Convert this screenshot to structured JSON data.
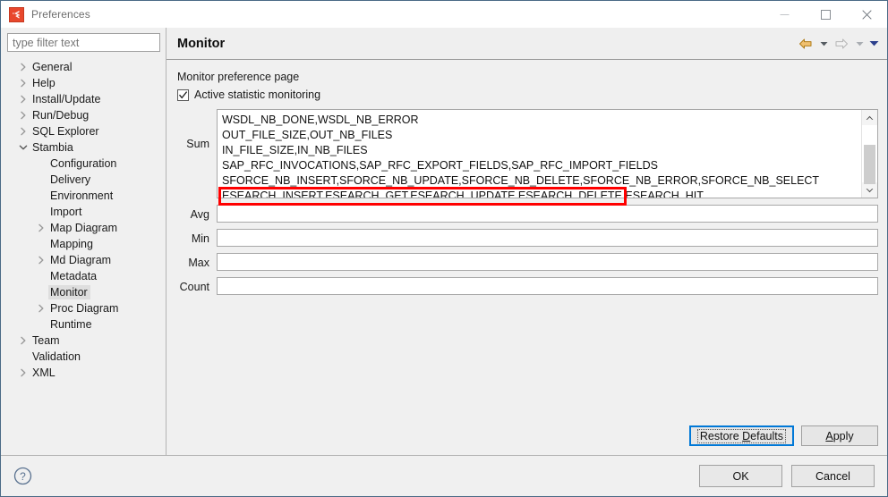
{
  "window": {
    "title": "Preferences",
    "icon": "stambia-logo-icon",
    "controls": {
      "minimize": "minimize-icon",
      "maximize": "maximize-icon",
      "close": "close-icon"
    }
  },
  "sidebar": {
    "filter": {
      "placeholder": "type filter text",
      "value": ""
    },
    "items": [
      {
        "label": "General",
        "indent": 0,
        "arrow": "collapsed",
        "selected": false
      },
      {
        "label": "Help",
        "indent": 0,
        "arrow": "collapsed",
        "selected": false
      },
      {
        "label": "Install/Update",
        "indent": 0,
        "arrow": "collapsed",
        "selected": false
      },
      {
        "label": "Run/Debug",
        "indent": 0,
        "arrow": "collapsed",
        "selected": false
      },
      {
        "label": "SQL Explorer",
        "indent": 0,
        "arrow": "collapsed",
        "selected": false
      },
      {
        "label": "Stambia",
        "indent": 0,
        "arrow": "expanded",
        "selected": false
      },
      {
        "label": "Configuration",
        "indent": 1,
        "arrow": "none",
        "selected": false
      },
      {
        "label": "Delivery",
        "indent": 1,
        "arrow": "none",
        "selected": false
      },
      {
        "label": "Environment",
        "indent": 1,
        "arrow": "none",
        "selected": false
      },
      {
        "label": "Import",
        "indent": 1,
        "arrow": "none",
        "selected": false
      },
      {
        "label": "Map Diagram",
        "indent": 1,
        "arrow": "collapsed",
        "selected": false
      },
      {
        "label": "Mapping",
        "indent": 1,
        "arrow": "none",
        "selected": false
      },
      {
        "label": "Md Diagram",
        "indent": 1,
        "arrow": "collapsed",
        "selected": false
      },
      {
        "label": "Metadata",
        "indent": 1,
        "arrow": "none",
        "selected": false
      },
      {
        "label": "Monitor",
        "indent": 1,
        "arrow": "none",
        "selected": true
      },
      {
        "label": "Proc Diagram",
        "indent": 1,
        "arrow": "collapsed",
        "selected": false
      },
      {
        "label": "Runtime",
        "indent": 1,
        "arrow": "none",
        "selected": false
      },
      {
        "label": "Team",
        "indent": 0,
        "arrow": "collapsed",
        "selected": false
      },
      {
        "label": "Validation",
        "indent": 0,
        "arrow": "none",
        "selected": false
      },
      {
        "label": "XML",
        "indent": 0,
        "arrow": "collapsed",
        "selected": false
      }
    ]
  },
  "page": {
    "title": "Monitor",
    "nav": {
      "back": "back-arrow-icon",
      "back_menu": "chevron-down-icon",
      "forward": "forward-arrow-icon",
      "forward_menu": "chevron-down-icon",
      "view_menu": "view-menu-chevron-icon"
    },
    "description": "Monitor preference page",
    "checkbox": {
      "label": "Active statistic monitoring",
      "checked": true
    },
    "fields": [
      {
        "label": "Sum",
        "type": "textarea",
        "lines": [
          "WSDL_NB_DONE,WSDL_NB_ERROR",
          "OUT_FILE_SIZE,OUT_NB_FILES",
          "IN_FILE_SIZE,IN_NB_FILES",
          "SAP_RFC_INVOCATIONS,SAP_RFC_EXPORT_FIELDS,SAP_RFC_IMPORT_FIELDS",
          "SFORCE_NB_INSERT,SFORCE_NB_UPDATE,SFORCE_NB_DELETE,SFORCE_NB_ERROR,SFORCE_NB_SELECT",
          "ESEARCH_INSERT,ESEARCH_GET,ESEARCH_UPDATE,ESEARCH_DELETE,ESEARCH_HIT"
        ],
        "highlighted_line_index": 5
      },
      {
        "label": "Avg",
        "type": "input",
        "value": ""
      },
      {
        "label": "Min",
        "type": "input",
        "value": ""
      },
      {
        "label": "Max",
        "type": "input",
        "value": ""
      },
      {
        "label": "Count",
        "type": "input",
        "value": ""
      }
    ],
    "buttons": {
      "restore_defaults": "Restore Defaults",
      "restore_defaults_mnemonic": "D",
      "apply": "Apply",
      "apply_mnemonic": "A"
    }
  },
  "footer": {
    "help_icon": "help-circle-icon",
    "ok": "OK",
    "cancel": "Cancel"
  },
  "colors": {
    "annotation_red": "#ff0000",
    "focus_blue": "#0078d7",
    "selection_grey": "#dedede",
    "logo_red": "#e8472c",
    "back_arrow_gold": "#e8a33d",
    "dropdown_navy": "#2b3f8c"
  }
}
